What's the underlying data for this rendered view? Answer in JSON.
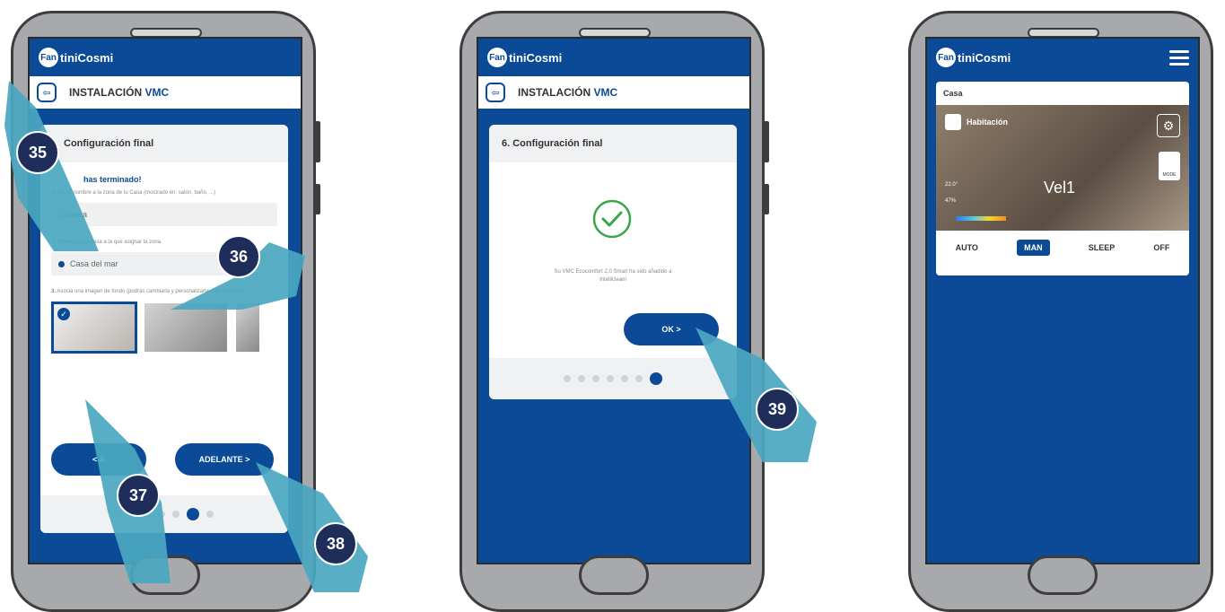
{
  "brand": {
    "logo_mark": "Fan",
    "logo_rest": "tiniCosmi"
  },
  "phone1": {
    "header_title": "INSTALACIÓN ",
    "header_accent": "VMC",
    "header_icon_label": "⇦",
    "card_title": "Configuración final",
    "step_done": "has terminado!",
    "instr1_lead": "1.",
    "instr1_text": "Da un nombre a la zona de tu Casa (mostrado en: salón, baño, ...)",
    "zone_value": "Camera",
    "instr2_lead": "2.",
    "instr2_text": "Selecciona la casa a la que asignar la zona",
    "house_value": "Casa del mar",
    "instr3_lead": "3.",
    "instr3_text": "Asocia una imagen de fondo (podrás cambiarla y personalizarla más adelante)",
    "back_label": "< A",
    "next_label": "ADELANTE >"
  },
  "phone2": {
    "header_title": "INSTALACIÓN ",
    "header_accent": "VMC",
    "card_title": "6. Configuración final",
    "message": "Su VMC Ecocomfort 2.0 Smart ha sido añadido a Intellicleanl",
    "ok_label": "OK >"
  },
  "phone3": {
    "home_label": "Casa",
    "room_label": "Habitación",
    "speed_label": "Vel1",
    "mode_badge": "MODE",
    "reading1": "22.0°",
    "reading2": "47%",
    "modes": [
      "AUTO",
      "MAN",
      "SLEEP",
      "OFF"
    ],
    "active_mode": "MAN"
  },
  "callouts": [
    "35",
    "36",
    "37",
    "38",
    "39"
  ],
  "colors": {
    "primary": "#0b4a96",
    "badge": "#1f2d5a",
    "hand": "#4aa7c0",
    "check": "#3aa648"
  }
}
